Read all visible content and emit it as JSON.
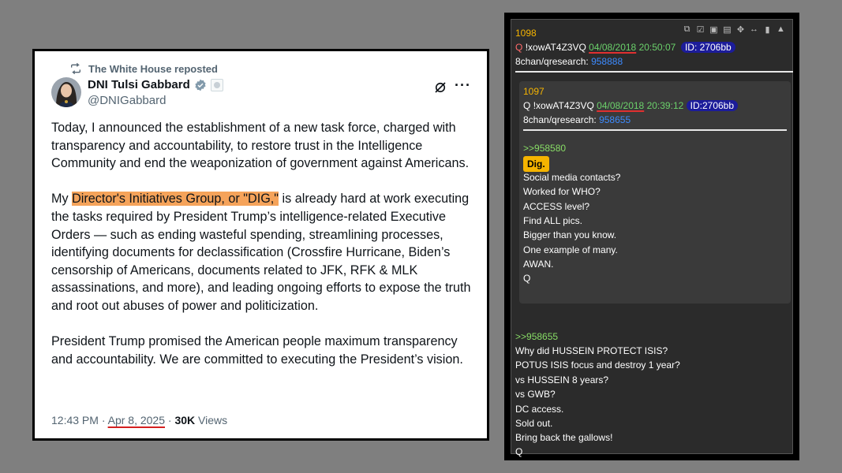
{
  "tweet": {
    "repost_label": "The White House reposted",
    "name": "DNI Tulsi Gabbard",
    "handle": "@DNIGabbard",
    "p1": "Today, I announced the establishment of a new task force, charged with transparency and accountability, to restore trust in the Intelligence Community and end the weaponization of government against Americans.",
    "p2_pre": "My ",
    "p2_highlight": "Director's Initiatives Group, or \"DIG,\"",
    "p2_post": " is already hard at work executing the tasks required by President Trump’s intelligence-related Executive Orders — such as ending wasteful spending, streamlining processes, identifying documents for declassification (Crossfire Hurricane, Biden’s censorship of Americans, documents related to JFK, RFK & MLK assassinations, and more), and leading ongoing efforts to expose the truth and root out abuses of power and politicization.",
    "p3": "President Trump promised the American people maximum transparency and accountability. We are committed to executing the President’s vision.",
    "time": "12:43 PM",
    "sep": " · ",
    "date": "Apr 8, 2025",
    "views_count": "30K",
    "views_label": " Views",
    "colors": {
      "highlight": "#f5a35a",
      "underline": "#d42020"
    },
    "icons": [
      "repost-icon",
      "verified-badge-icon",
      "gov-badge-icon",
      "grok-icon",
      "more-icon"
    ]
  },
  "post": {
    "number": "1098",
    "q": "Q",
    "tripcode": "!xowAT4Z3VQ",
    "date": "04/08/2018",
    "time": "20:50:07",
    "id": "ID: 2706bb",
    "board": "8chan/qresearch:",
    "board_link": "958888",
    "icons": [
      "share-icon",
      "check-icon",
      "vr-icon",
      "doc-icon",
      "move-icon",
      "resize-icon",
      "trash-icon",
      "up-icon"
    ],
    "quoted": {
      "number": "1097",
      "q": "Q",
      "tripcode": "!xowAT4Z3VQ",
      "date": "04/08/2018",
      "time": "20:39:12",
      "id": "ID:2706bb",
      "board": "8chan/qresearch:",
      "board_link": "958655",
      "reply_ref": ">>958580",
      "badge": "Dig.",
      "lines": [
        "Social media contacts?",
        "Worked for WHO?",
        "ACCESS level?",
        "Find ALL pics.",
        "Bigger than you know.",
        "One example of many.",
        "AWAN.",
        "Q"
      ]
    },
    "reply_ref": ">>958655",
    "lines": [
      "Why did HUSSEIN PROTECT ISIS?",
      "POTUS ISIS focus and destroy 1 year?",
      "vs HUSSEIN 8 years?",
      "vs GWB?",
      "DC access.",
      "Sold out.",
      "Bring back the gallows!",
      "Q"
    ]
  }
}
